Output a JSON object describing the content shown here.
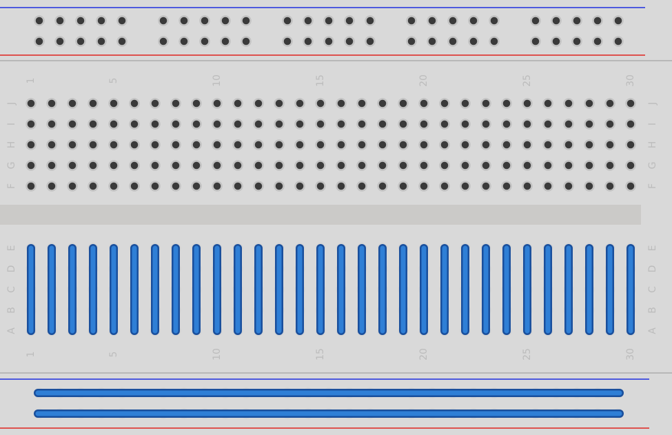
{
  "title": "",
  "colors": {
    "board": "#d9d9d9",
    "center_channel": "#cbcac8",
    "rail_blue": "#1f2fe0",
    "rail_red": "#e0241f",
    "separator": "#b8b8b8",
    "hole_fill": "#3a3a3a",
    "hole_ring": "#c2c2c2",
    "label": "#bcbcbc",
    "connection_fill": "#2f7fd6",
    "connection_outline": "#1a4f9c"
  },
  "icons": [
    "breadcrumb-hole-icon"
  ],
  "breadboard": {
    "columns": 30,
    "column_number_labels": [
      "1",
      "5",
      "10",
      "15",
      "20",
      "25",
      "30"
    ],
    "top_rows": [
      "J",
      "I",
      "H",
      "G",
      "F"
    ],
    "bottom_rows": [
      "E",
      "D",
      "C",
      "B",
      "A"
    ],
    "power_rail_groups": 5,
    "power_rail_holes_per_group": 5,
    "highlighted_columns_bottom_half": [
      1,
      2,
      3,
      4,
      5,
      6,
      7,
      8,
      9,
      10,
      11,
      12,
      13,
      14,
      15,
      16,
      17,
      18,
      19,
      20,
      21,
      22,
      23,
      24,
      25,
      26,
      27,
      28,
      29,
      30
    ],
    "highlighted_bottom_rails": [
      "upper",
      "lower"
    ]
  }
}
